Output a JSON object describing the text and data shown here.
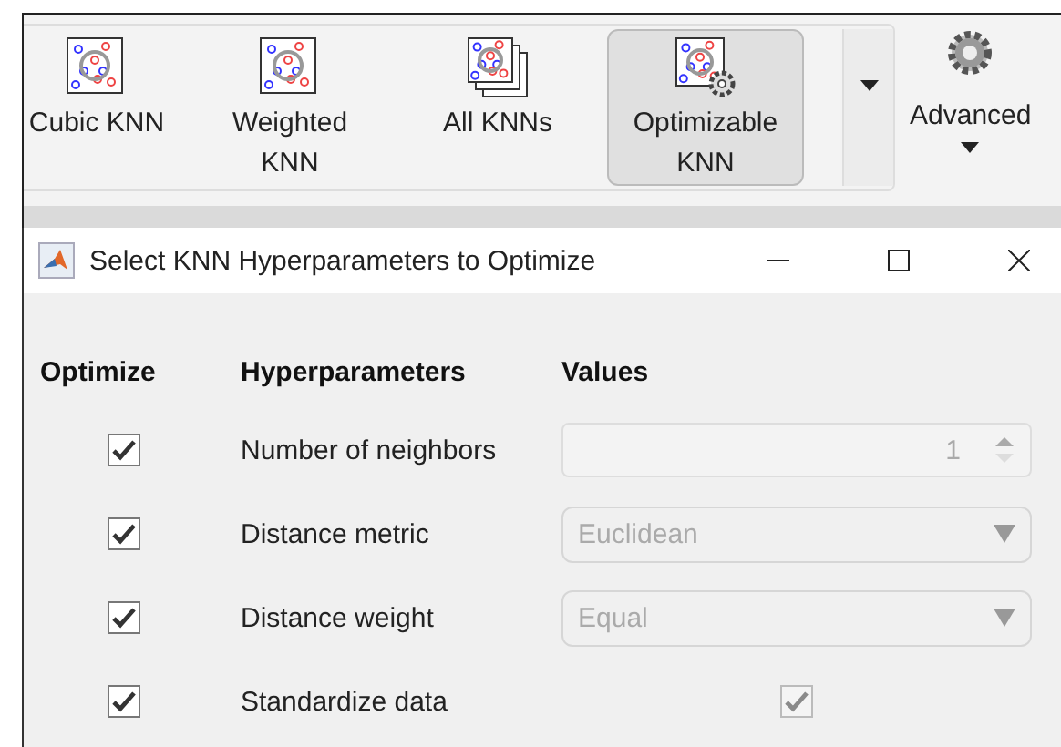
{
  "ribbon": {
    "gallery": [
      {
        "label": "Cubic KNN",
        "kind": "single",
        "selected": false
      },
      {
        "label": "Weighted KNN",
        "kind": "single",
        "selected": false
      },
      {
        "label": "All KNNs",
        "kind": "stack",
        "selected": false
      },
      {
        "label": "Optimizable KNN",
        "kind": "gear",
        "selected": true
      }
    ],
    "advanced": {
      "label": "Advanced"
    }
  },
  "dialog": {
    "title": "Select KNN Hyperparameters to Optimize",
    "columns": [
      "Optimize",
      "Hyperparameters",
      "Values"
    ],
    "rows": [
      {
        "kind": "spinner",
        "optimize": true,
        "name": "Number of neighbors",
        "value": "1",
        "disabled": true
      },
      {
        "kind": "dropdown",
        "optimize": true,
        "name": "Distance metric",
        "value": "Euclidean",
        "disabled": true
      },
      {
        "kind": "dropdown",
        "optimize": true,
        "name": "Distance weight",
        "value": "Equal",
        "disabled": true
      },
      {
        "kind": "checkbox",
        "optimize": true,
        "name": "Standardize data",
        "checked": true,
        "disabled": true
      }
    ]
  }
}
